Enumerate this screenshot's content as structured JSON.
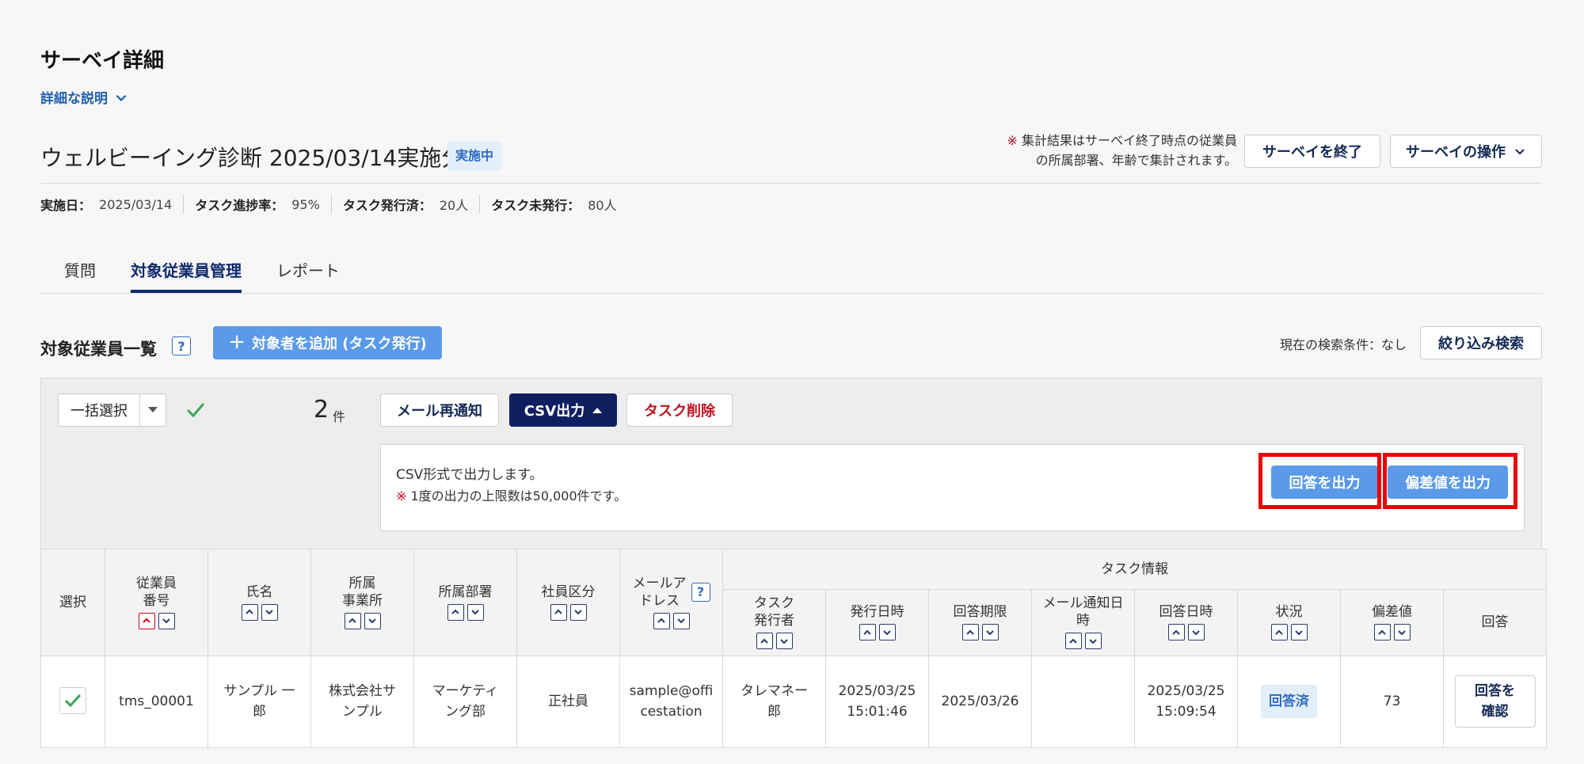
{
  "page": {
    "title": "サーベイ詳細",
    "detail_toggle": "詳細な説明"
  },
  "survey": {
    "name": "ウェルビーイング診断 2025/03/14実施分",
    "status": "実施中",
    "notice_mark": "※",
    "notice_line1": "集計結果はサーベイ終了時点の従業員",
    "notice_line2": "の所属部署、年齢で集計されます。",
    "end_button": "サーベイを終了",
    "ops_button": "サーベイの操作"
  },
  "meta": {
    "date_label": "実施日：",
    "date_value": "2025/03/14",
    "progress_label": "タスク進捗率：",
    "progress_value": "95%",
    "issued_label": "タスク発行済：",
    "issued_value": "20人",
    "unissued_label": "タスク未発行：",
    "unissued_value": "80人"
  },
  "tabs": [
    "質問",
    "対象従業員管理",
    "レポート"
  ],
  "list": {
    "title": "対象従業員一覧",
    "help": "?",
    "add_button": "対象者を追加 (タスク発行)",
    "search_condition": "現在の検索条件：なし",
    "filter_button": "絞り込み検索"
  },
  "toolbar": {
    "bulk_select": "一括選択",
    "count": "2",
    "count_unit": "件",
    "mail_button": "メール再通知",
    "csv_button": "CSV出力",
    "delete_button": "タスク削除"
  },
  "csv": {
    "message": "CSV形式で出力します。",
    "note_mark": "※",
    "note": "1度の出力の上限数は50,000件です。",
    "answers_button": "回答を出力",
    "deviation_button": "偏差値を出力"
  },
  "table": {
    "headers": {
      "select": "選択",
      "emp_no": [
        "従業員",
        "番号"
      ],
      "name": "氏名",
      "office": [
        "所属",
        "事業所"
      ],
      "dept": "所属部署",
      "emp_type": "社員区分",
      "email": [
        "メールア",
        "ドレス"
      ],
      "task_group": "タスク情報",
      "issuer": [
        "タスク",
        "発行者"
      ],
      "issued_at": "発行日時",
      "deadline": "回答期限",
      "mail_notified": [
        "メール通知日",
        "時"
      ],
      "answered_at": "回答日時",
      "status": "状況",
      "deviation": "偏差値",
      "answer": "回答"
    },
    "rows": [
      {
        "emp_no": "tms_00001",
        "name": [
          "サンプル 一",
          "郎"
        ],
        "office": [
          "株式会社サ",
          "ンプル"
        ],
        "dept": [
          "マーケティ",
          "ング部"
        ],
        "emp_type": "正社員",
        "email": [
          "sample@offi",
          "cestation"
        ],
        "issuer": [
          "タレマネー",
          "郎"
        ],
        "issued_at": [
          "2025/03/25",
          "15:01:46"
        ],
        "deadline": "2025/03/26",
        "mail_notified": "",
        "answered_at": [
          "2025/03/25",
          "15:09:54"
        ],
        "status": "回答済",
        "deviation": "73",
        "answer_button": [
          "回答を",
          "確認"
        ]
      }
    ]
  },
  "colors": {
    "primary_dark": "#0f1f60",
    "accent_blue": "#5a9ae8",
    "link_blue": "#1f5fae",
    "danger": "#c0101e",
    "highlight_red": "#ee0000",
    "success_green": "#3aa655"
  }
}
